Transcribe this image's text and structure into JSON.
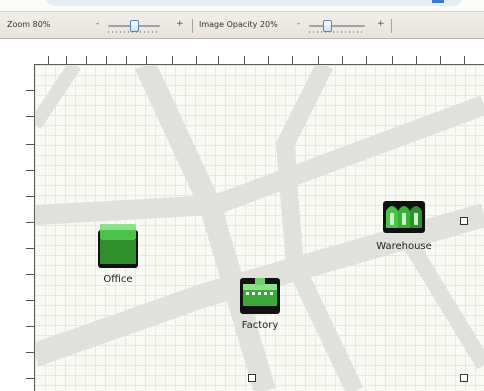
{
  "toolbar": {
    "zoom": {
      "label": "Zoom 80%",
      "minus": "-",
      "plus": "+",
      "value_pct": 80
    },
    "image_opacity": {
      "label": "Image Opacity 20%",
      "minus": "-",
      "plus": "+",
      "value_pct": 20
    }
  },
  "canvas": {
    "nodes": [
      {
        "label": "Office",
        "icon": "office-building-icon"
      },
      {
        "label": "Factory",
        "icon": "factory-icon"
      },
      {
        "label": "Warehouse",
        "icon": "warehouse-icon"
      }
    ]
  },
  "colors": {
    "node_green": "#3fa83a",
    "road_gray": "#e2e2df",
    "grid": "#e8e8df"
  }
}
